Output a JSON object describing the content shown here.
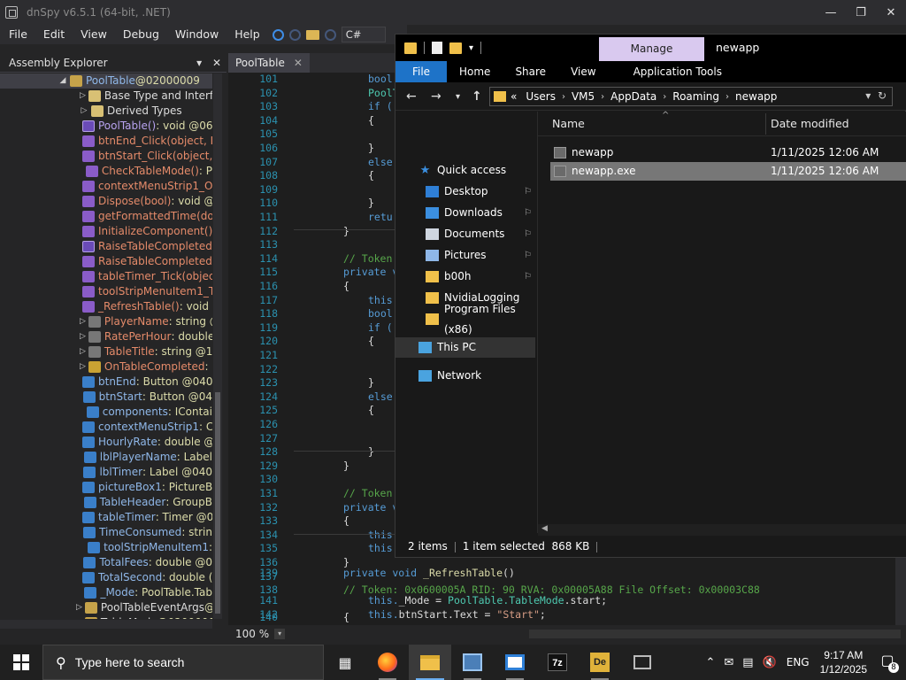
{
  "dnspy": {
    "title": "dnSpy v6.5.1 (64-bit, .NET)",
    "menu": [
      "File",
      "Edit",
      "View",
      "Debug",
      "Window",
      "Help"
    ],
    "language": "C#",
    "assembly_explorer": {
      "title": "Assembly Explorer",
      "items": [
        {
          "name": "PoolTable",
          "type": " @02000009",
          "kind": "class"
        },
        {
          "name": "Base Type and Interfac",
          "type": "",
          "kind": "folder"
        },
        {
          "name": "Derived Types",
          "type": "",
          "kind": "folder"
        },
        {
          "name": "PoolTable()",
          "type": " : void @06",
          "kind": "method-pub"
        },
        {
          "name": "btnEnd_Click(object, E",
          "type": "",
          "kind": "method"
        },
        {
          "name": "btnStart_Click(object,",
          "type": "",
          "kind": "method"
        },
        {
          "name": "CheckTableMode()",
          "type": " : P",
          "kind": "method"
        },
        {
          "name": "contextMenuStrip1_O",
          "type": "",
          "kind": "method"
        },
        {
          "name": "Dispose(bool)",
          "type": " : void @",
          "kind": "method"
        },
        {
          "name": "getFormattedTime(do",
          "type": "",
          "kind": "method"
        },
        {
          "name": "InitializeComponent()",
          "type": "",
          "kind": "method"
        },
        {
          "name": "RaiseTableCompleted(",
          "type": "",
          "kind": "method-pub"
        },
        {
          "name": "RaiseTableCompleted(",
          "type": "",
          "kind": "method"
        },
        {
          "name": "tableTimer_Tick(objec",
          "type": "",
          "kind": "method"
        },
        {
          "name": "toolStripMenuItem1_T",
          "type": "",
          "kind": "method"
        },
        {
          "name": "_RefreshTable()",
          "type": " : void (",
          "kind": "method"
        },
        {
          "name": "PlayerName",
          "type": " : string @",
          "kind": "prop"
        },
        {
          "name": "RatePerHour",
          "type": " : double",
          "kind": "prop"
        },
        {
          "name": "TableTitle",
          "type": " : string @17",
          "kind": "prop"
        },
        {
          "name": "OnTableCompleted",
          "type": " : E",
          "kind": "event"
        },
        {
          "name": "btnEnd",
          "type": " : Button @040",
          "kind": "field"
        },
        {
          "name": "btnStart",
          "type": " : Button @04",
          "kind": "field"
        },
        {
          "name": "components",
          "type": " : IContai",
          "kind": "field"
        },
        {
          "name": "contextMenuStrip1",
          "type": " : C",
          "kind": "field"
        },
        {
          "name": "HourlyRate",
          "type": " : double @",
          "kind": "field"
        },
        {
          "name": "lblPlayerName",
          "type": " : Label",
          "kind": "field"
        },
        {
          "name": "lblTimer",
          "type": " : Label @040",
          "kind": "field"
        },
        {
          "name": "pictureBox1",
          "type": " : PictureB",
          "kind": "field"
        },
        {
          "name": "TableHeader",
          "type": " : GroupB",
          "kind": "field"
        },
        {
          "name": "tableTimer",
          "type": " : Timer @0",
          "kind": "field"
        },
        {
          "name": "TimeConsumed",
          "type": " : strin",
          "kind": "field"
        },
        {
          "name": "toolStripMenuItem1",
          "type": " :",
          "kind": "field"
        },
        {
          "name": "TotalFees",
          "type": " : double @0",
          "kind": "field"
        },
        {
          "name": "TotalSecond",
          "type": " : double (",
          "kind": "field"
        },
        {
          "name": "_Mode",
          "type": " : PoolTable.Tab",
          "kind": "field"
        },
        {
          "name": "PoolTableEventArgs",
          "type": " @",
          "kind": "class"
        },
        {
          "name": "TableMode",
          "type": " @0200000",
          "kind": "class"
        }
      ]
    },
    "editor": {
      "tab": "PoolTable",
      "zoom": "100 %",
      "line_numbers": [
        "101",
        "102",
        "103",
        "104",
        "105",
        "106",
        "107",
        "108",
        "109",
        "110",
        "111",
        "112",
        "113",
        "114",
        "115",
        "116",
        "117",
        "118",
        "119",
        "120",
        "121",
        "122",
        "123",
        "124",
        "125",
        "126",
        "127",
        "128",
        "129",
        "130",
        "131",
        "132",
        "133",
        "134",
        "135",
        "136",
        "137",
        "138",
        "139",
        "140",
        "141",
        "142"
      ],
      "code_lines": [
        {
          "ln": 0,
          "indent": 1,
          "text": "bool",
          "cls": "kw"
        },
        {
          "ln": 1,
          "indent": 1,
          "text": "PoolT",
          "cls": "ty"
        },
        {
          "ln": 2,
          "indent": 1,
          "text": "if (",
          "cls": "kw"
        },
        {
          "ln": 3,
          "indent": 1,
          "text": "{",
          "cls": "pr"
        },
        {
          "ln": 5,
          "indent": 1,
          "text": "}",
          "cls": "pr"
        },
        {
          "ln": 6,
          "indent": 1,
          "text": "else",
          "cls": "kw"
        },
        {
          "ln": 7,
          "indent": 1,
          "text": "{",
          "cls": "pr"
        },
        {
          "ln": 9,
          "indent": 1,
          "text": "}",
          "cls": "pr"
        },
        {
          "ln": 10,
          "indent": 1,
          "text": "retu",
          "cls": "kw"
        },
        {
          "ln": 11,
          "indent": 0,
          "text": "}",
          "cls": "pr"
        },
        {
          "ln": 13,
          "indent": 0,
          "text": "// Token",
          "cls": "cm"
        },
        {
          "ln": 14,
          "indent": 0,
          "text": "private v",
          "cls": "kw"
        },
        {
          "ln": 15,
          "indent": 0,
          "text": "{",
          "cls": "pr"
        },
        {
          "ln": 16,
          "indent": 1,
          "text": "this.",
          "cls": "kw"
        },
        {
          "ln": 17,
          "indent": 1,
          "text": "bool",
          "cls": "kw"
        },
        {
          "ln": 18,
          "indent": 1,
          "text": "if (",
          "cls": "kw"
        },
        {
          "ln": 19,
          "indent": 1,
          "text": "{",
          "cls": "pr"
        },
        {
          "ln": 22,
          "indent": 1,
          "text": "}",
          "cls": "pr"
        },
        {
          "ln": 23,
          "indent": 1,
          "text": "else",
          "cls": "kw"
        },
        {
          "ln": 24,
          "indent": 1,
          "text": "{",
          "cls": "pr"
        },
        {
          "ln": 27,
          "indent": 1,
          "text": "}",
          "cls": "pr"
        },
        {
          "ln": 28,
          "indent": 0,
          "text": "}",
          "cls": "pr"
        },
        {
          "ln": 30,
          "indent": 0,
          "text": "// Token",
          "cls": "cm"
        },
        {
          "ln": 31,
          "indent": 0,
          "text": "private v",
          "cls": "kw"
        },
        {
          "ln": 32,
          "indent": 0,
          "text": "{",
          "cls": "pr"
        },
        {
          "ln": 33,
          "indent": 1,
          "text": "this",
          "cls": "kw"
        },
        {
          "ln": 34,
          "indent": 1,
          "text": "this",
          "cls": "kw"
        },
        {
          "ln": 35,
          "indent": 0,
          "text": "}",
          "cls": "pr"
        },
        {
          "ln": 37,
          "indent": 0,
          "text": "// Token: 0x0600005A RID: 90 RVA: 0x00005A88 File Offset: 0x00003C88",
          "cls": "cm"
        },
        {
          "ln": 39,
          "indent": 0,
          "text": "{",
          "cls": "pr"
        }
      ],
      "line139_kw": "private void ",
      "line139_fn": "_RefreshTable",
      "line139_tail": "()",
      "line141_a": "this.",
      "line141_b": "_Mode = ",
      "line141_c": "PoolTable.TableMode",
      "line141_d": ".start;",
      "line142_a": "this.",
      "line142_b": "btnStart.Text = ",
      "line142_c": "\"Start\"",
      "line142_d": ";"
    }
  },
  "explorer": {
    "manage_tab": "Manage",
    "window_title": "newapp",
    "ribbon_tabs": [
      "File",
      "Home",
      "Share",
      "View",
      "Application Tools"
    ],
    "breadcrumb": [
      "Users",
      "VM5",
      "AppData",
      "Roaming",
      "newapp"
    ],
    "breadcrumb_prefix": "«",
    "nav": [
      {
        "label": "Quick access",
        "icon": "star",
        "pinned": false
      },
      {
        "label": "Desktop",
        "icon": "desktop",
        "pinned": true
      },
      {
        "label": "Downloads",
        "icon": "download",
        "pinned": true
      },
      {
        "label": "Documents",
        "icon": "doc",
        "pinned": true
      },
      {
        "label": "Pictures",
        "icon": "pic",
        "pinned": true
      },
      {
        "label": "b00h",
        "icon": "folder",
        "pinned": true
      },
      {
        "label": "NvidiaLogging",
        "icon": "folder",
        "pinned": false
      },
      {
        "label": "Program Files (x86)",
        "icon": "folder",
        "pinned": false
      },
      {
        "label": "This PC",
        "icon": "pc",
        "pinned": false
      },
      {
        "label": "Network",
        "icon": "network",
        "pinned": false
      }
    ],
    "columns": {
      "name": "Name",
      "date": "Date modified"
    },
    "files": [
      {
        "name": "newapp",
        "date": "1/11/2025 12:06 AM",
        "selected": false
      },
      {
        "name": "newapp.exe",
        "date": "1/11/2025 12:06 AM",
        "selected": true
      }
    ],
    "status": {
      "items": "2 items",
      "selected": "1 item selected",
      "size": "868 KB"
    }
  },
  "taskbar": {
    "search_placeholder": "Type here to search",
    "language": "ENG",
    "time": "9:17 AM",
    "date": "1/12/2025",
    "notification_count": "8",
    "apps": [
      "task-view",
      "firefox",
      "file-explorer",
      "dnspy",
      "remote-desktop",
      "7zip",
      "detect-it-easy",
      "virtualbox"
    ]
  },
  "colors": {
    "accent": "#1e73c8",
    "manage_tab": "#d9c9ef",
    "comment": "#57a64a",
    "keyword": "#569cd6"
  }
}
